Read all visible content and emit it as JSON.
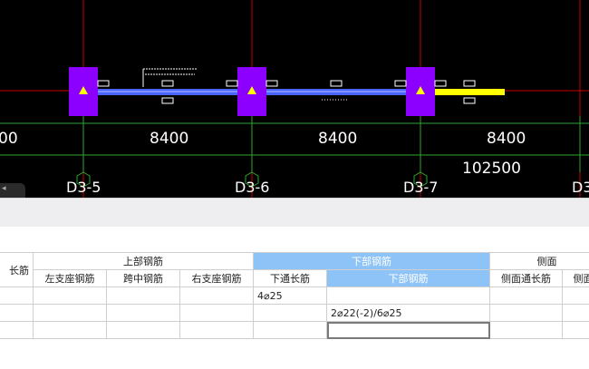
{
  "canvas": {
    "spans": [
      "00",
      "8400",
      "8400",
      "8400"
    ],
    "total_length": "102500",
    "axes": [
      "D3-5",
      "D3-6",
      "D3-7",
      "D3"
    ],
    "tiny_label_1": "\u0000\u0000\u0000\u0000\u0000\u0000\u0000\u0000\u0000\u0000",
    "tiny_label_2": "\u0000\u0000\u0000\u0000\u0000",
    "colors": {
      "background": "#000000",
      "grid_red": "#cc0000",
      "grid_green": "#2fa82f",
      "column": "#8b00ff",
      "beam": "#4a64ff",
      "highlight": "#ffff00"
    }
  },
  "table": {
    "header_groups": {
      "left_partial": "长筋",
      "top": "上部钢筋",
      "bottom": "下部钢筋",
      "side": "侧面"
    },
    "columns": [
      "左支座钢筋",
      "跨中钢筋",
      "右支座钢筋",
      "下通长筋",
      "下部钢筋",
      "侧面通长筋",
      "侧面"
    ],
    "rows": [
      [
        "",
        "",
        "",
        "",
        "4⌀25",
        "",
        "",
        ""
      ],
      [
        "",
        "",
        "",
        "",
        "",
        "2⌀22(-2)/6⌀25",
        "",
        ""
      ],
      [
        "",
        "",
        "",
        "",
        "",
        "",
        "",
        ""
      ]
    ]
  }
}
